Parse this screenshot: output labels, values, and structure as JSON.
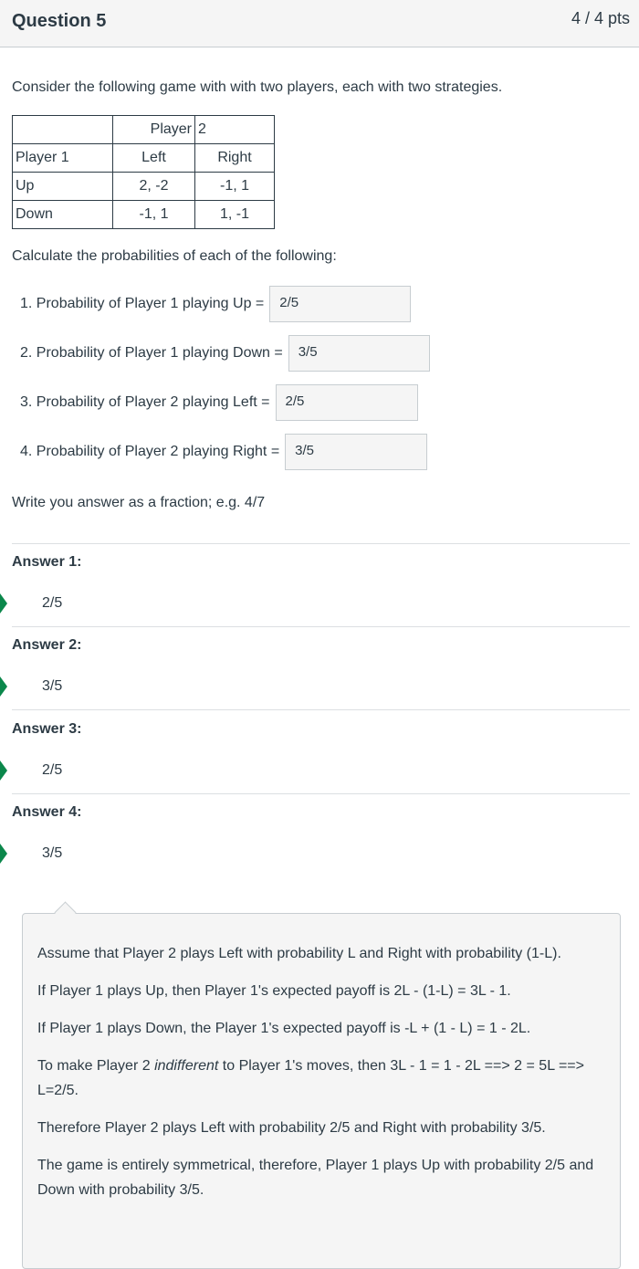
{
  "header": {
    "title": "Question 5",
    "points": "4 / 4 pts"
  },
  "intro": "Consider the following game with with two players, each with two strategies.",
  "payoff_table": {
    "rows": [
      [
        "",
        "Player",
        "2"
      ],
      [
        "Player 1",
        "Left",
        "Right"
      ],
      [
        "Up",
        "2, -2",
        "-1, 1"
      ],
      [
        "Down",
        "-1, 1",
        "1, -1"
      ]
    ]
  },
  "calc_text": "Calculate the probabilities of each of the following:",
  "items": [
    {
      "label": "1. Probability of Player 1 playing Up =",
      "value": "2/5"
    },
    {
      "label": "2. Probability of Player 1 playing Down =",
      "value": "3/5"
    },
    {
      "label": "3. Probability of Player 2 playing Left =",
      "value": "2/5"
    },
    {
      "label": "4. Probability of Player 2 playing Right =",
      "value": "3/5"
    }
  ],
  "instruction": "Write you answer as a fraction; e.g. 4/7",
  "answers": [
    {
      "label": "Answer 1:",
      "value": "2/5"
    },
    {
      "label": "Answer 2:",
      "value": "3/5"
    },
    {
      "label": "Answer 3:",
      "value": "2/5"
    },
    {
      "label": "Answer 4:",
      "value": "3/5"
    }
  ],
  "feedback": {
    "p1": "Assume that Player 2 plays Left with probability L and Right with probability (1-L).",
    "p2": "If Player 1 plays Up, then Player 1's expected payoff is 2L - (1-L) = 3L - 1.",
    "p3": "If Player 1 plays Down, the Player 1's expected payoff is -L + (1 - L) = 1 - 2L.",
    "p4_pre": "To make Player 2 ",
    "p4_em": "indifferent",
    "p4_post": " to Player 1's moves, then 3L - 1 = 1 - 2L  ==> 2 = 5L ==> L=2/5.",
    "p5": "Therefore Player 2 plays  Left with probability 2/5 and Right with probability 3/5.",
    "p6": "The game is entirely symmetrical, therefore, Player 1 plays Up with probability 2/5 and Down with probability 3/5."
  },
  "colors": {
    "correct_arrow": "#0b874b",
    "header_bg": "#f5f5f5",
    "text": "#2d3b45"
  }
}
